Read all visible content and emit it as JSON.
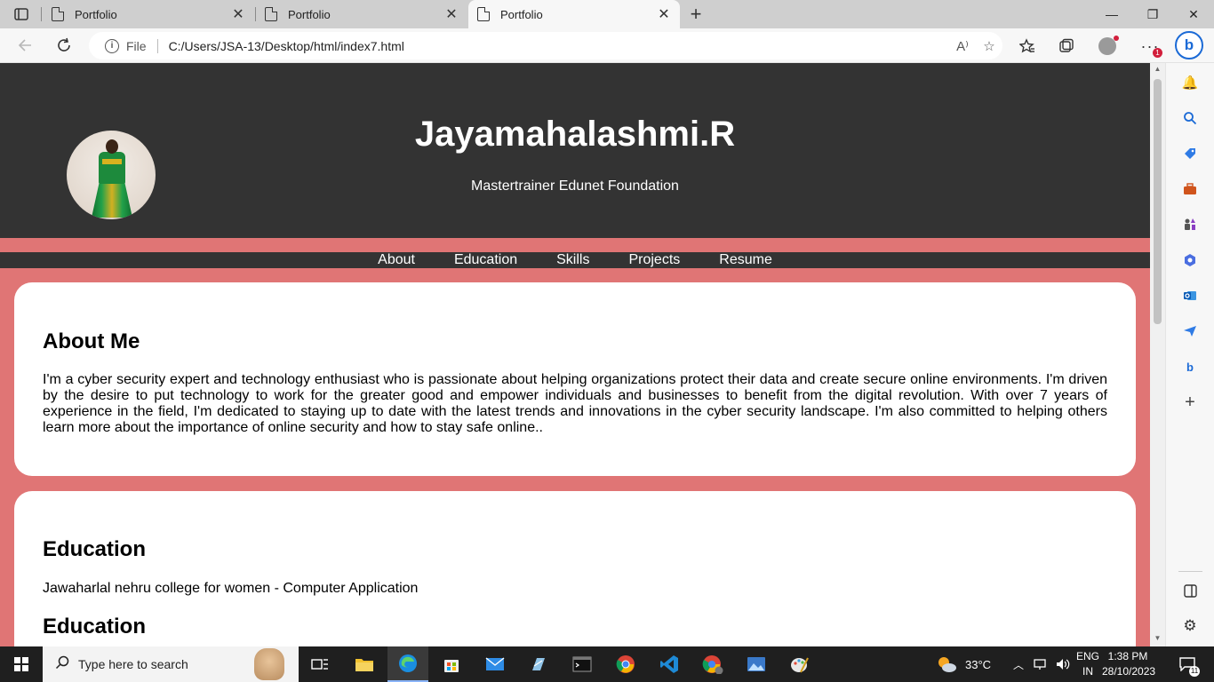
{
  "browser": {
    "tabs": [
      {
        "title": "Portfolio",
        "active": false
      },
      {
        "title": "Portfolio",
        "active": false
      },
      {
        "title": "Portfolio",
        "active": true
      }
    ],
    "new_tab_glyph": "+",
    "window_controls": {
      "minimize": "—",
      "restore": "❐",
      "close": "✕"
    },
    "address": {
      "scheme_label": "File",
      "url": "C:/Users/JSA-13/Desktop/html/index7.html"
    },
    "notification_count": "1",
    "bing_label": "b"
  },
  "page": {
    "header": {
      "name": "Jayamahalashmi.R",
      "tagline": "Mastertrainer Edunet Foundation"
    },
    "nav": [
      "About",
      "Education",
      "Skills",
      "Projects",
      "Resume"
    ],
    "about": {
      "heading": "About Me",
      "body": "I'm a cyber security expert and technology enthusiast who is passionate about helping organizations protect their data and create secure online environments. I'm driven by the desire to put technology to work for the greater good and empower individuals and businesses to benefit from the digital revolution. With over 7 years of experience in the field, I'm dedicated to staying up to date with the latest trends and innovations in the cyber security landscape. I'm also committed to helping others learn more about the importance of online security and how to stay safe online.."
    },
    "education": {
      "heading": "Education",
      "entry": "Jawaharlal nehru college for women - Computer Application",
      "heading2": "Education"
    }
  },
  "taskbar": {
    "search_placeholder": "Type here to search",
    "weather": "33°C",
    "lang_line1": "ENG",
    "lang_line2": "IN",
    "time": "1:38 PM",
    "date": "28/10/2023",
    "notification_count": "11"
  },
  "colors": {
    "header_bg": "#333333",
    "page_bg": "#e07575",
    "card_bg": "#ffffff",
    "accent_blue": "#1b6ad6"
  }
}
